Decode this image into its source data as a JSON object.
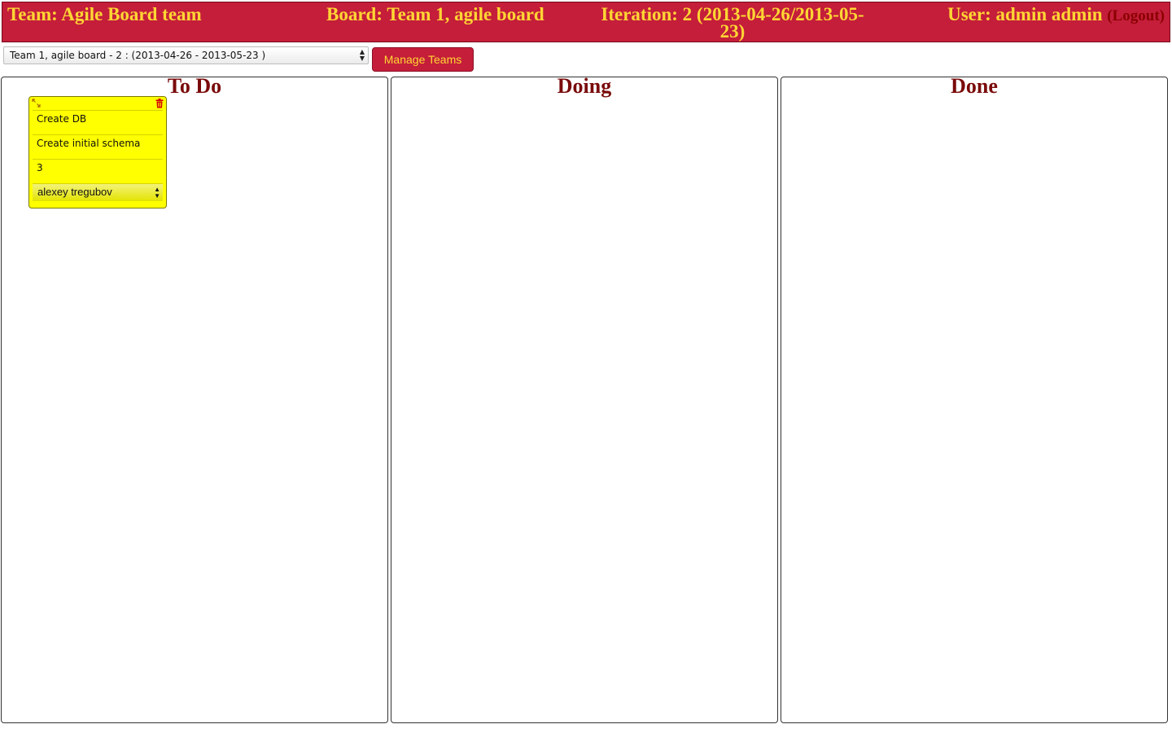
{
  "header": {
    "team": "Team: Agile Board team",
    "board": "Board: Team 1, agile board",
    "iteration": "Iteration: 2 (2013-04-26/2013-05-23)",
    "user": "User: admin admin",
    "logout": "(Logout)"
  },
  "toolbar": {
    "board_select_value": "Team 1, agile board - 2 : (2013-04-26 - 2013-05-23 )",
    "manage_teams_label": "Manage Teams"
  },
  "columns": [
    {
      "title": "To Do"
    },
    {
      "title": "Doing"
    },
    {
      "title": "Done"
    }
  ],
  "card": {
    "title": "Create DB",
    "description": "Create initial schema",
    "estimate": "3",
    "assignee": "alexey tregubov"
  },
  "colors": {
    "header_bg": "#c41e3a",
    "header_text": "#ffd633",
    "column_title": "#7a0a0a",
    "card_bg": "#ffff00"
  },
  "icons": {
    "expand": "expand-icon",
    "delete": "trash-icon",
    "select_arrows": "select-arrows-icon"
  }
}
